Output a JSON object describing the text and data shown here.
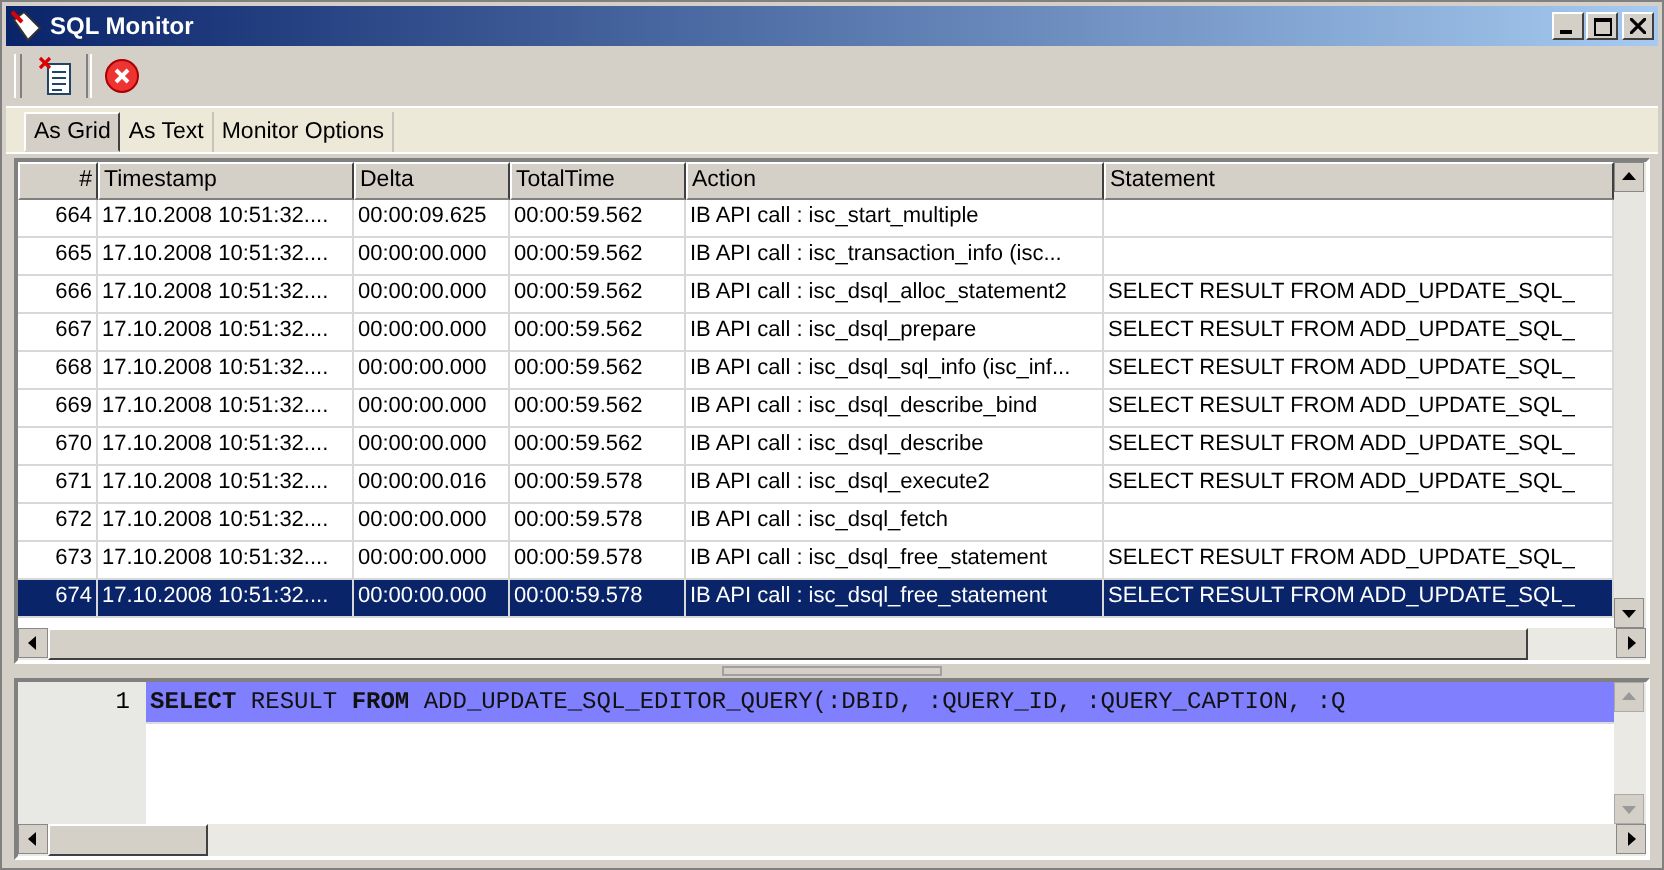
{
  "window": {
    "title": "SQL Monitor"
  },
  "toolbar": {
    "buttons": [
      {
        "kind": "clear"
      },
      {
        "kind": "stop"
      }
    ]
  },
  "tabs": [
    {
      "label": "As Grid",
      "selected": true
    },
    {
      "label": "As Text",
      "selected": false
    },
    {
      "label": "Monitor Options",
      "selected": false
    }
  ],
  "grid": {
    "columns": [
      "#",
      "Timestamp",
      "Delta",
      "TotalTime",
      "Action",
      "Statement"
    ],
    "rows": [
      {
        "number": "664",
        "timestamp": "17.10.2008 10:51:32....",
        "delta": "00:00:09.625",
        "total_time": "00:00:59.562",
        "action": "IB API call : isc_start_multiple",
        "selected": false
      },
      {
        "number": "665",
        "timestamp": "17.10.2008 10:51:32....",
        "delta": "00:00:00.000",
        "total_time": "00:00:59.562",
        "action": "IB API call : isc_transaction_info (isc...",
        "selected": false
      },
      {
        "number": "666",
        "timestamp": "17.10.2008 10:51:32....",
        "delta": "00:00:00.000",
        "total_time": "00:00:59.562",
        "action": "IB API call : isc_dsql_alloc_statement2",
        "statement": "SELECT RESULT FROM ADD_UPDATE_SQL_",
        "selected": false
      },
      {
        "number": "667",
        "timestamp": "17.10.2008 10:51:32....",
        "delta": "00:00:00.000",
        "total_time": "00:00:59.562",
        "action": "IB API call : isc_dsql_prepare",
        "statement": "SELECT RESULT FROM ADD_UPDATE_SQL_",
        "selected": false
      },
      {
        "number": "668",
        "timestamp": "17.10.2008 10:51:32....",
        "delta": "00:00:00.000",
        "total_time": "00:00:59.562",
        "action": "IB API call : isc_dsql_sql_info (isc_inf...",
        "statement": "SELECT RESULT FROM ADD_UPDATE_SQL_",
        "selected": false
      },
      {
        "number": "669",
        "timestamp": "17.10.2008 10:51:32....",
        "delta": "00:00:00.000",
        "total_time": "00:00:59.562",
        "action": "IB API call : isc_dsql_describe_bind",
        "statement": "SELECT RESULT FROM ADD_UPDATE_SQL_",
        "selected": false
      },
      {
        "number": "670",
        "timestamp": "17.10.2008 10:51:32....",
        "delta": "00:00:00.000",
        "total_time": "00:00:59.562",
        "action": "IB API call : isc_dsql_describe",
        "statement": "SELECT RESULT FROM ADD_UPDATE_SQL_",
        "selected": false
      },
      {
        "number": "671",
        "timestamp": "17.10.2008 10:51:32....",
        "delta": "00:00:00.016",
        "total_time": "00:00:59.578",
        "action": "IB API call : isc_dsql_execute2",
        "statement": "SELECT RESULT FROM ADD_UPDATE_SQL_",
        "selected": false
      },
      {
        "number": "672",
        "timestamp": "17.10.2008 10:51:32....",
        "delta": "00:00:00.000",
        "total_time": "00:00:59.578",
        "action": "IB API call : isc_dsql_fetch",
        "selected": false
      },
      {
        "number": "673",
        "timestamp": "17.10.2008 10:51:32....",
        "delta": "00:00:00.000",
        "total_time": "00:00:59.578",
        "action": "IB API call : isc_dsql_free_statement",
        "statement": "SELECT RESULT FROM ADD_UPDATE_SQL_",
        "selected": false
      },
      {
        "number": "674",
        "timestamp": "17.10.2008 10:51:32....",
        "delta": "00:00:00.000",
        "total_time": "00:00:59.578",
        "action": "IB API call : isc_dsql_free_statement",
        "statement": "SELECT RESULT FROM ADD_UPDATE_SQL_",
        "selected": true
      }
    ]
  },
  "editor": {
    "lines": [
      {
        "number": "1",
        "text": "**SELECT** RESULT **FROM** ADD_UPDATE_SQL_EDITOR_QUERY(:DBID, :QUERY_ID, :QUERY_CAPTION, :Q",
        "highlighted": true
      }
    ]
  }
}
